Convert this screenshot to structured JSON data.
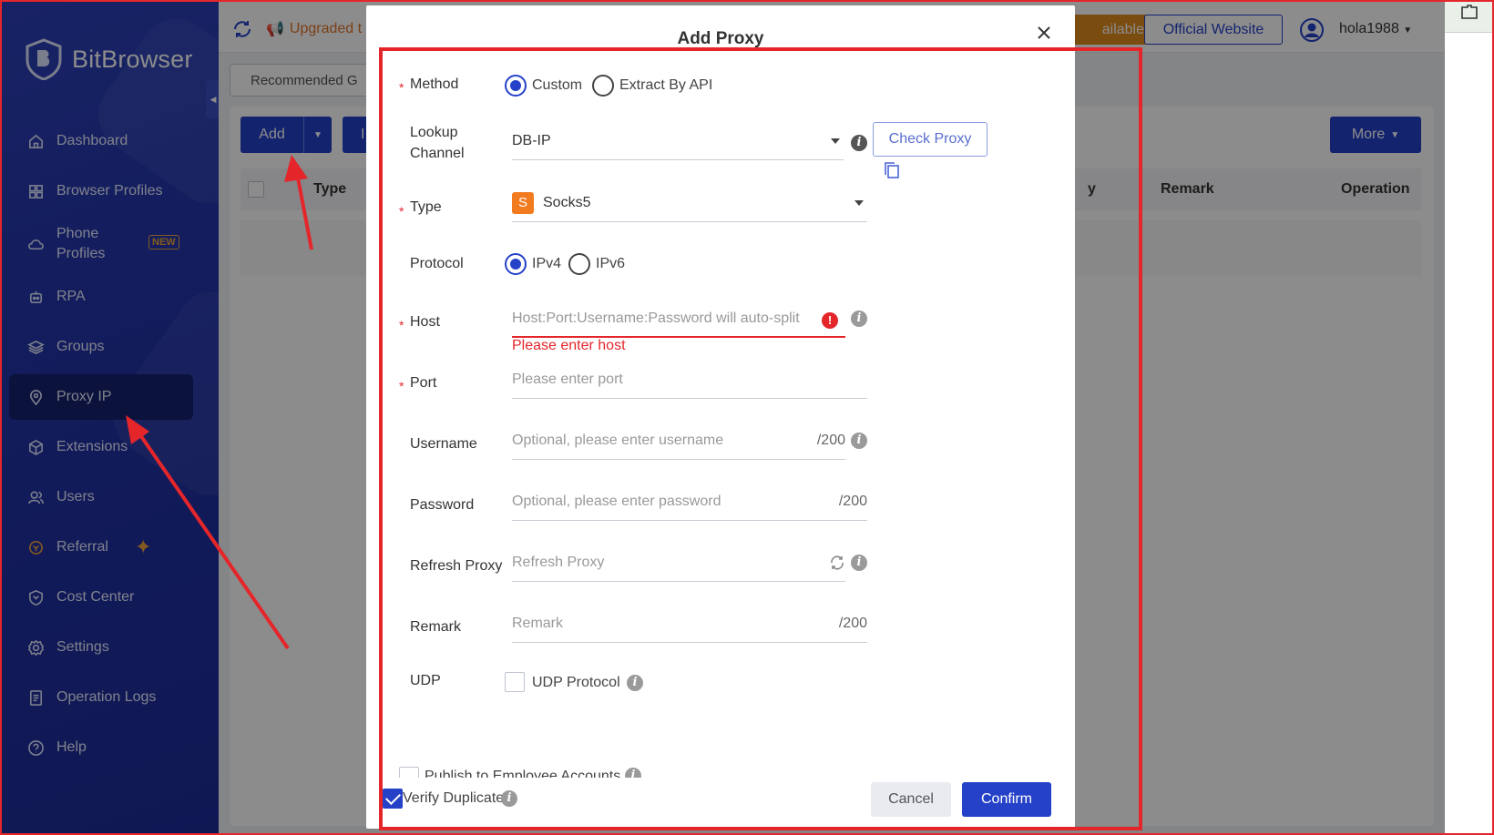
{
  "app": {
    "brand": "BitBrowser"
  },
  "sidebar": {
    "items": [
      {
        "label": "Dashboard",
        "icon": "home-icon"
      },
      {
        "label": "Browser Profiles",
        "icon": "grid-icon"
      },
      {
        "label": "Phone Profiles",
        "icon": "cloud-phone-icon",
        "badge": "NEW"
      },
      {
        "label": "RPA",
        "icon": "robot-icon"
      },
      {
        "label": "Groups",
        "icon": "layers-icon"
      },
      {
        "label": "Proxy IP",
        "icon": "location-pin-icon",
        "active": true
      },
      {
        "label": "Extensions",
        "icon": "cube-icon"
      },
      {
        "label": "Users",
        "icon": "users-icon"
      },
      {
        "label": "Referral",
        "icon": "referral-icon"
      },
      {
        "label": "Cost Center",
        "icon": "shield-icon"
      },
      {
        "label": "Settings",
        "icon": "gear-icon"
      },
      {
        "label": "Operation Logs",
        "icon": "document-icon"
      },
      {
        "label": "Help",
        "icon": "help-icon"
      }
    ]
  },
  "topbar": {
    "notice": "Upgraded t",
    "available_btn": "ailable",
    "official_btn": "Official Website",
    "username": "hola1988"
  },
  "page": {
    "tab_recommended": "Recommended G",
    "add_btn": "Add",
    "partial_btn": "I",
    "more_btn": "More",
    "columns": {
      "type": "Type",
      "y": "y",
      "remark": "Remark",
      "operation": "Operation"
    }
  },
  "modal": {
    "title": "Add Proxy",
    "method": {
      "label": "Method",
      "options": [
        "Custom",
        "Extract By API"
      ],
      "selected": "Custom"
    },
    "lookup": {
      "label_line1": "Lookup",
      "label_line2": "Channel",
      "value": "DB-IP",
      "check_btn": "Check Proxy"
    },
    "type": {
      "label": "Type",
      "badge": "S",
      "value": "Socks5"
    },
    "protocol": {
      "label": "Protocol",
      "options": [
        "IPv4",
        "IPv6"
      ],
      "selected": "IPv4"
    },
    "host": {
      "label": "Host",
      "placeholder": "Host:Port:Username:Password will auto-split",
      "error": "Please enter host"
    },
    "port": {
      "label": "Port",
      "placeholder": "Please enter port"
    },
    "username": {
      "label": "Username",
      "placeholder": "Optional, please enter username",
      "counter": "/200"
    },
    "password": {
      "label": "Password",
      "placeholder": "Optional, please enter password",
      "counter": "/200"
    },
    "refresh": {
      "label": "Refresh Proxy",
      "placeholder": "Refresh Proxy"
    },
    "remark": {
      "label": "Remark",
      "placeholder": "Remark",
      "counter": "/200"
    },
    "udp": {
      "label": "UDP",
      "checkbox_label": "UDP Protocol",
      "checked": false
    },
    "publish": {
      "label": "Publish to Employee Accounts"
    },
    "verify": {
      "label": "Verify Duplicates",
      "checked": true
    },
    "cancel_btn": "Cancel",
    "confirm_btn": "Confirm"
  },
  "colors": {
    "primary": "#2541c8",
    "sidebar": "#2233a6",
    "error": "#e4262b",
    "annotation": "#e4262b"
  }
}
